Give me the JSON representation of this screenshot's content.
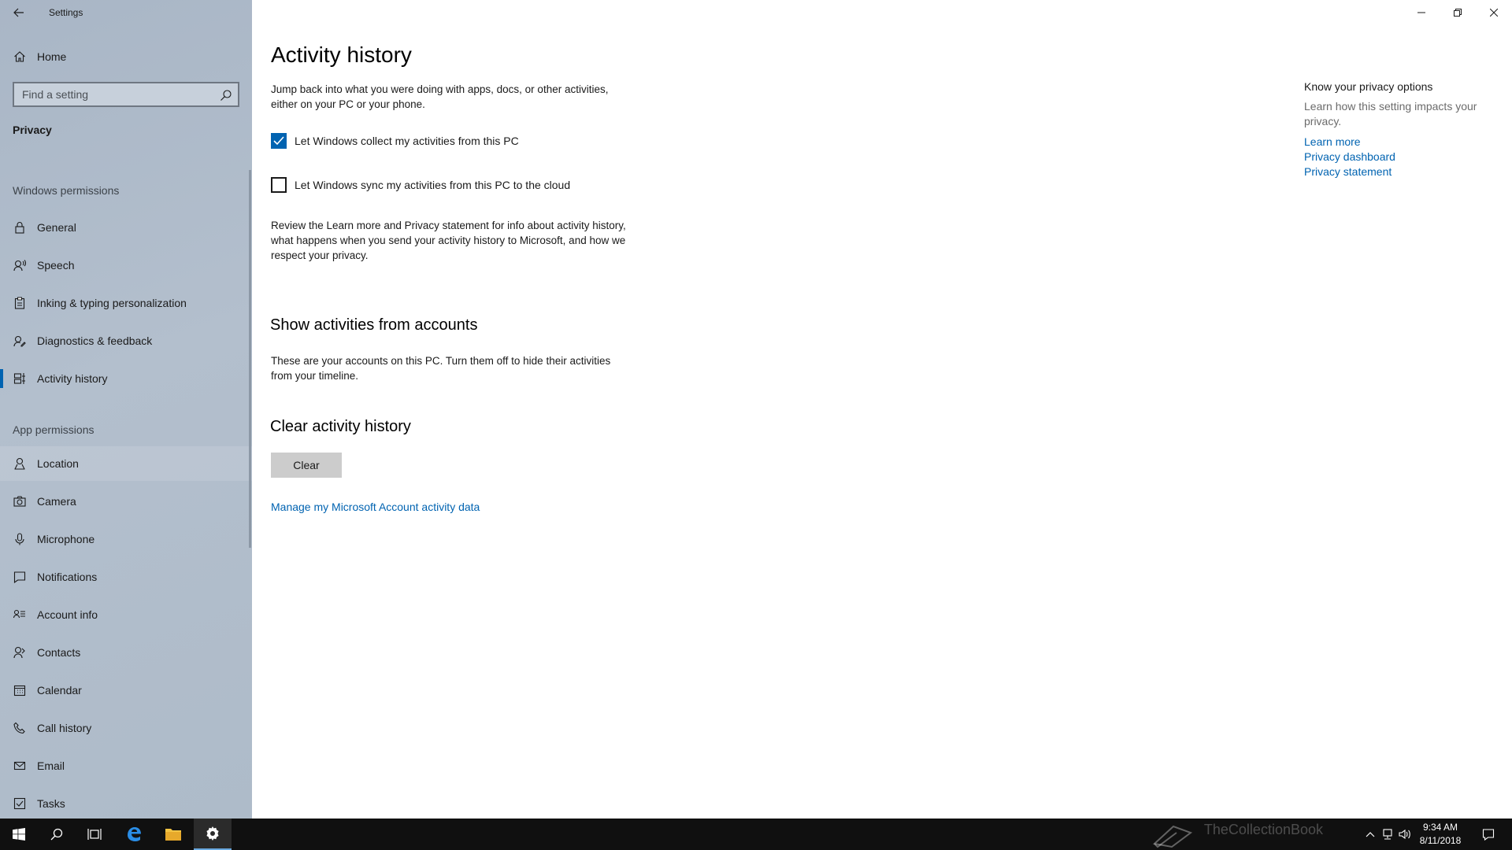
{
  "app": {
    "title": "Settings"
  },
  "sidebar": {
    "home_label": "Home",
    "search_placeholder": "Find a setting",
    "category": "Privacy",
    "windows_permissions_heading": "Windows permissions",
    "windows_permissions": [
      {
        "label": "General",
        "icon": "lock-icon"
      },
      {
        "label": "Speech",
        "icon": "speech-icon"
      },
      {
        "label": "Inking & typing personalization",
        "icon": "clipboard-icon"
      },
      {
        "label": "Diagnostics & feedback",
        "icon": "feedback-icon"
      },
      {
        "label": "Activity history",
        "icon": "timeline-icon",
        "selected": true
      }
    ],
    "app_permissions_heading": "App permissions",
    "app_permissions": [
      {
        "label": "Location",
        "icon": "location-icon",
        "hover": true
      },
      {
        "label": "Camera",
        "icon": "camera-icon"
      },
      {
        "label": "Microphone",
        "icon": "microphone-icon"
      },
      {
        "label": "Notifications",
        "icon": "notifications-icon"
      },
      {
        "label": "Account info",
        "icon": "account-info-icon"
      },
      {
        "label": "Contacts",
        "icon": "contacts-icon"
      },
      {
        "label": "Calendar",
        "icon": "calendar-icon"
      },
      {
        "label": "Call history",
        "icon": "call-history-icon"
      },
      {
        "label": "Email",
        "icon": "email-icon"
      },
      {
        "label": "Tasks",
        "icon": "tasks-icon"
      }
    ]
  },
  "main": {
    "title": "Activity history",
    "intro": "Jump back into what you were doing with apps, docs, or other activities, either on your PC or your phone.",
    "checkbox_collect": {
      "label": "Let Windows collect my activities from this PC",
      "checked": true
    },
    "checkbox_sync": {
      "label": "Let Windows sync my activities from this PC to the cloud",
      "checked": false
    },
    "review_text": "Review the Learn more and Privacy statement for info about activity history, what happens when you send your activity history to Microsoft, and how we respect your privacy.",
    "accounts_title": "Show activities from accounts",
    "accounts_text": "These are your accounts on this PC. Turn them off to hide their activities from your timeline.",
    "clear_title": "Clear activity history",
    "clear_button": "Clear",
    "manage_link": "Manage my Microsoft Account activity data"
  },
  "related": {
    "title": "Know your privacy options",
    "description": "Learn how this setting impacts your privacy.",
    "links": [
      "Learn more",
      "Privacy dashboard",
      "Privacy statement"
    ]
  },
  "taskbar": {
    "time": "9:34 AM",
    "date": "8/11/2018",
    "watermark": "TheCollectionBook"
  },
  "colors": {
    "accent": "#0063b1",
    "sidebar_bg": "#aebbc9",
    "taskbar_bg": "#101010"
  }
}
